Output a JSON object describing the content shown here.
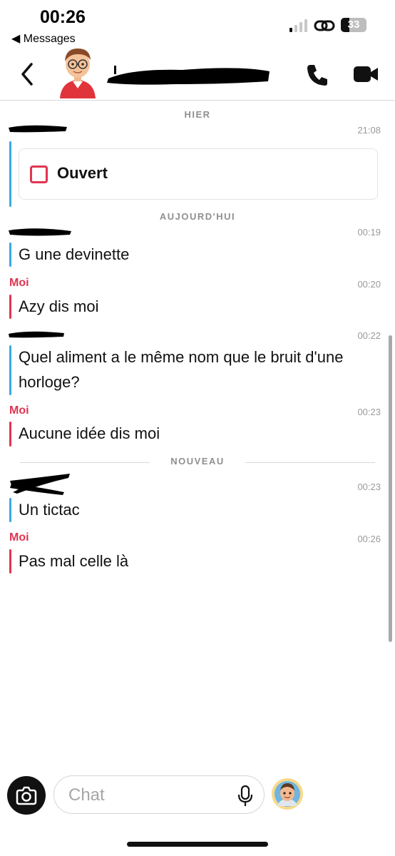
{
  "status_bar": {
    "time": "00:26",
    "back_app": "◀ Messages",
    "battery": "33"
  },
  "header": {
    "contact_name": ""
  },
  "messages": [
    {
      "type": "day",
      "label": "HIER"
    },
    {
      "type": "snap",
      "sender": "",
      "time": "21:08",
      "status": "Ouvert"
    },
    {
      "type": "day",
      "label": "AUJOURD'HUI"
    },
    {
      "type": "text",
      "sender": "",
      "time": "00:19",
      "text": "G une devinette"
    },
    {
      "type": "text",
      "sender": "Moi",
      "time": "00:20",
      "text": "Azy dis moi"
    },
    {
      "type": "text",
      "sender": "",
      "time": "00:22",
      "text": "Quel aliment a le même nom que le bruit d'une horloge?"
    },
    {
      "type": "text",
      "sender": "Moi",
      "time": "00:23",
      "text": "Aucune idée dis moi"
    },
    {
      "type": "divider",
      "label": "NOUVEAU"
    },
    {
      "type": "text",
      "sender": "",
      "time": "00:23",
      "text": "Un tictac"
    },
    {
      "type": "text",
      "sender": "Moi",
      "time": "00:26",
      "text": "Pas mal celle là"
    }
  ],
  "composer": {
    "placeholder": "Chat"
  },
  "colors": {
    "friend": "#3aa9e3",
    "me": "#e03551"
  },
  "icons": [
    "back-arrow-icon",
    "phone-icon",
    "video-camera-icon",
    "camera-icon",
    "microphone-icon",
    "bitmoji-icon",
    "link-icon",
    "signal-icon"
  ]
}
